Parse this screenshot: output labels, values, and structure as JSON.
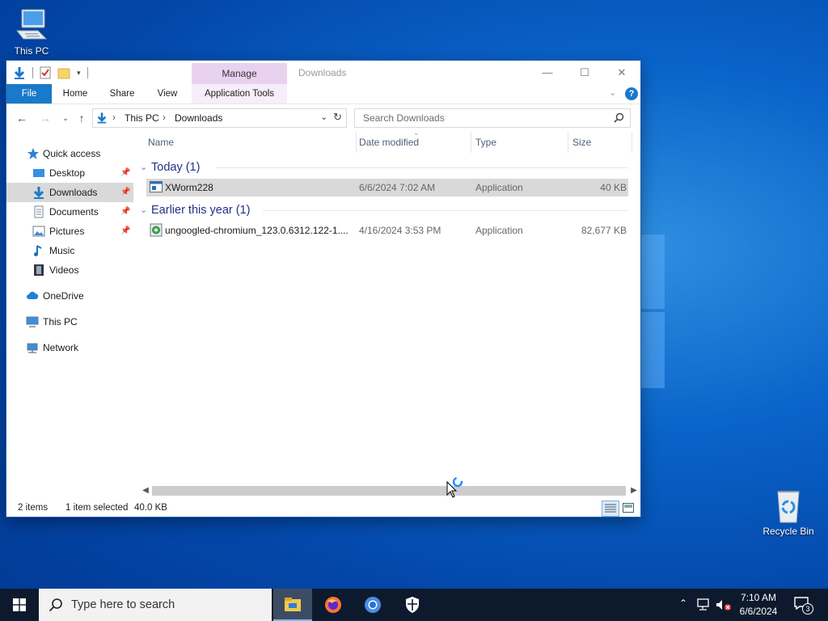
{
  "desktop": {
    "this_pc_label": "This PC",
    "recycle_bin_label": "Recycle Bin"
  },
  "window": {
    "title": "Downloads",
    "context_tab": "Manage",
    "controls": {
      "minimize": "—",
      "maximize": "☐",
      "close": "✕"
    }
  },
  "ribbon": {
    "tabs": [
      "File",
      "Home",
      "Share",
      "View",
      "Application Tools"
    ],
    "help": "?"
  },
  "address_bar": {
    "breadcrumbs": [
      "This PC",
      "Downloads"
    ],
    "separator": "›"
  },
  "search": {
    "placeholder": "Search Downloads"
  },
  "nav_pane": {
    "items": [
      {
        "label": "Quick access",
        "icon": "star-icon"
      },
      {
        "label": "Desktop",
        "icon": "desktop-icon",
        "pinned": true
      },
      {
        "label": "Downloads",
        "icon": "download-arrow-icon",
        "pinned": true,
        "selected": true
      },
      {
        "label": "Documents",
        "icon": "documents-icon",
        "pinned": true
      },
      {
        "label": "Pictures",
        "icon": "pictures-icon",
        "pinned": true
      },
      {
        "label": "Music",
        "icon": "music-icon"
      },
      {
        "label": "Videos",
        "icon": "videos-icon"
      },
      {
        "label": "OneDrive",
        "icon": "cloud-icon"
      },
      {
        "label": "This PC",
        "icon": "computer-icon"
      },
      {
        "label": "Network",
        "icon": "network-icon"
      }
    ]
  },
  "file_list": {
    "columns": [
      "Name",
      "Date modified",
      "Type",
      "Size"
    ],
    "groups": [
      {
        "header": "Today (1)",
        "rows": [
          {
            "name": "XWorm228",
            "date": "6/6/2024 7:02 AM",
            "type": "Application",
            "size": "40 KB",
            "selected": true,
            "icon": "application-icon"
          }
        ]
      },
      {
        "header": "Earlier this year (1)",
        "rows": [
          {
            "name": "ungoogled-chromium_123.0.6312.122-1....",
            "date": "4/16/2024 3:53 PM",
            "type": "Application",
            "size": "82,677 KB",
            "selected": false,
            "icon": "chromium-installer-icon"
          }
        ]
      }
    ]
  },
  "status_bar": {
    "item_count": "2 items",
    "selection": "1 item selected",
    "selection_size": "40.0 KB"
  },
  "taskbar": {
    "search_placeholder": "Type here to search",
    "apps": [
      "file-explorer-icon",
      "firefox-icon",
      "chrome-icon",
      "security-shield-icon"
    ],
    "clock_time": "7:10 AM",
    "clock_date": "6/6/2024",
    "notification_count": "3"
  },
  "colors": {
    "accent": "#1979ca",
    "manage_tab": "#e9d2f0",
    "group_header": "#1e3287",
    "selection": "#d9d9d9",
    "taskbar": "#0d1a2e"
  }
}
